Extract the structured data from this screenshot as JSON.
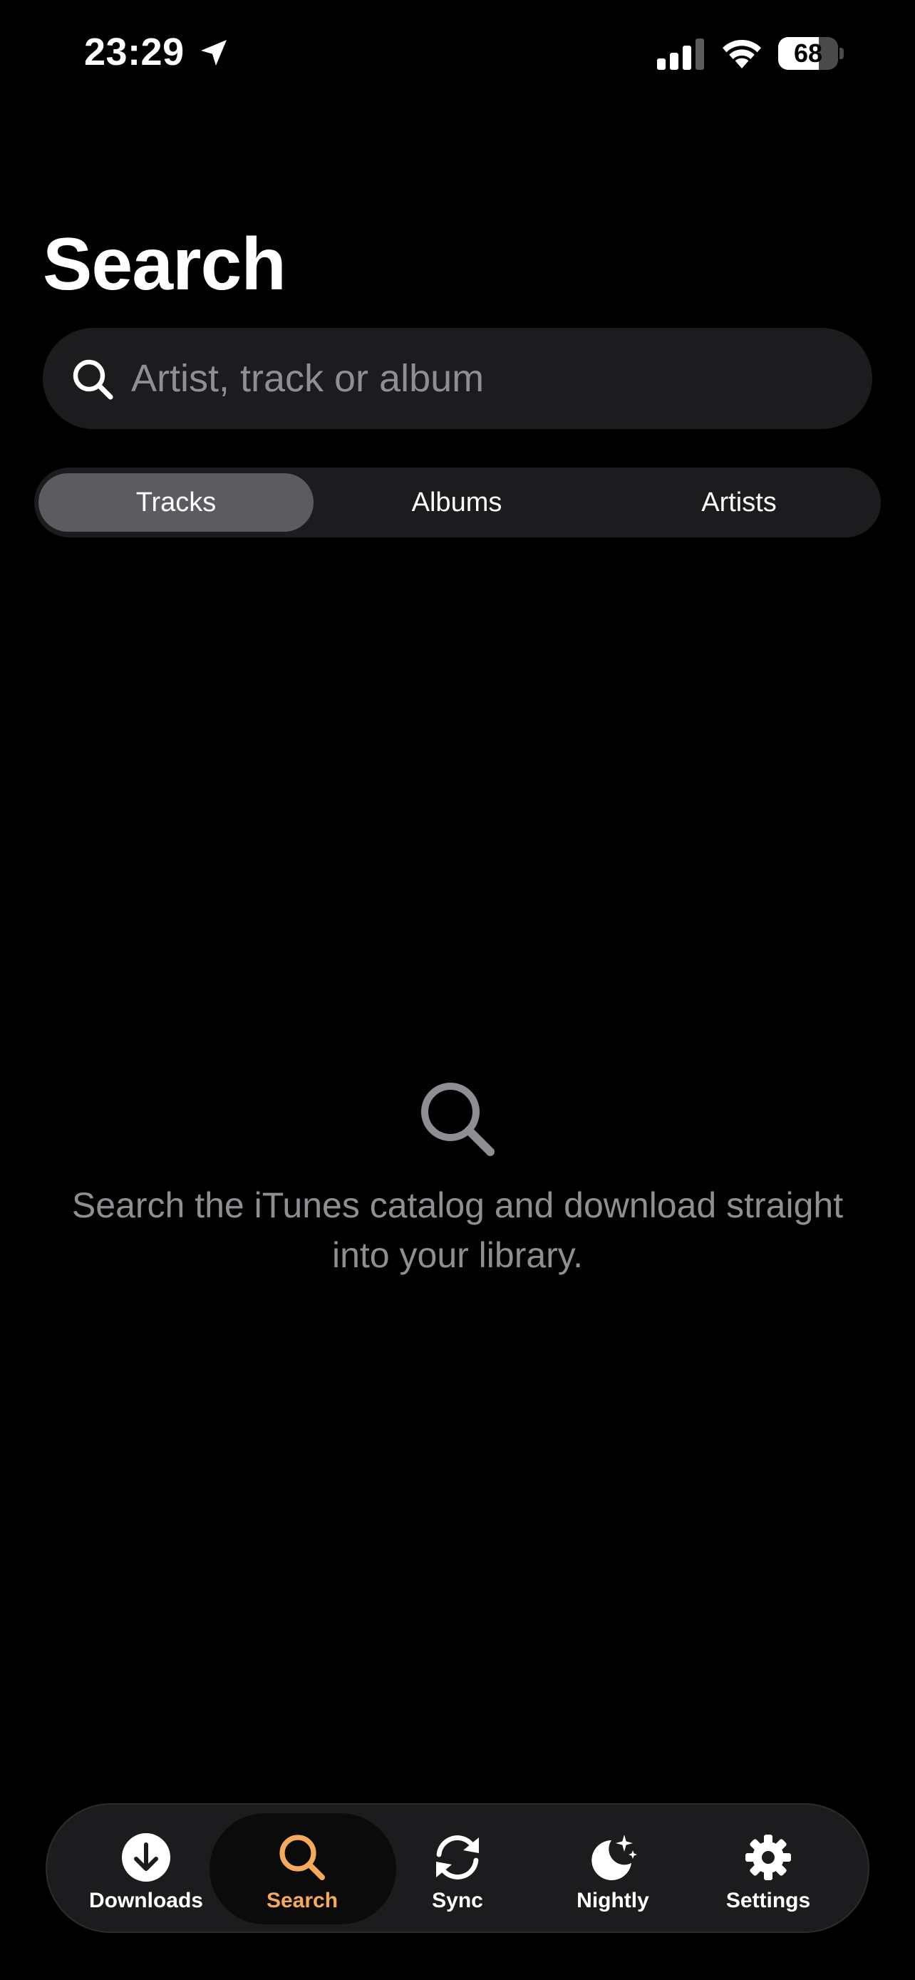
{
  "status_bar": {
    "time": "23:29",
    "battery_percent": "68",
    "battery_level": 0.68
  },
  "page": {
    "title": "Search"
  },
  "search": {
    "placeholder": "Artist, track or album",
    "value": ""
  },
  "segments": [
    {
      "label": "Tracks",
      "selected": true
    },
    {
      "label": "Albums",
      "selected": false
    },
    {
      "label": "Artists",
      "selected": false
    }
  ],
  "empty_state": {
    "icon": "search-icon",
    "message": "Search the iTunes catalog and download straight into your library."
  },
  "tabs": [
    {
      "label": "Downloads",
      "icon": "download-circle-icon",
      "active": false
    },
    {
      "label": "Search",
      "icon": "search-icon",
      "active": true
    },
    {
      "label": "Sync",
      "icon": "sync-icon",
      "active": false
    },
    {
      "label": "Nightly",
      "icon": "moon-stars-icon",
      "active": false
    },
    {
      "label": "Settings",
      "icon": "gear-icon",
      "active": false
    }
  ],
  "colors": {
    "background": "#000000",
    "surface": "#1c1c1e",
    "segment_selected": "#5c5c60",
    "secondary_text": "#8e8e93",
    "accent": "#f5a95b"
  }
}
